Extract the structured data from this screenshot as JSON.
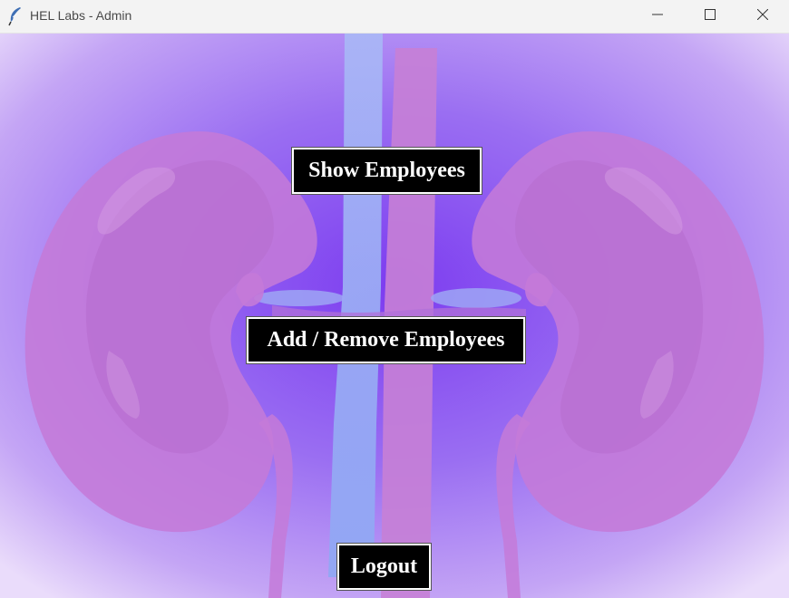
{
  "window": {
    "title": "HEL Labs - Admin",
    "app_icon": "feather-icon",
    "controls": {
      "minimize_icon": "minimize-icon",
      "maximize_icon": "maximize-icon",
      "close_icon": "close-icon"
    }
  },
  "background": {
    "illustration": "kidneys-illustration",
    "colors": {
      "base": "#9a6ef2",
      "edge": "#e6d6fb",
      "kidney": "#c47ad8",
      "vein": "#9fb6f5",
      "artery": "#c77fd6"
    }
  },
  "actions": {
    "show_employees": "Show Employees",
    "add_remove_employees": "Add / Remove Employees",
    "logout": "Logout"
  },
  "colors": {
    "button_bg": "#000000",
    "button_text": "#ffffff"
  }
}
